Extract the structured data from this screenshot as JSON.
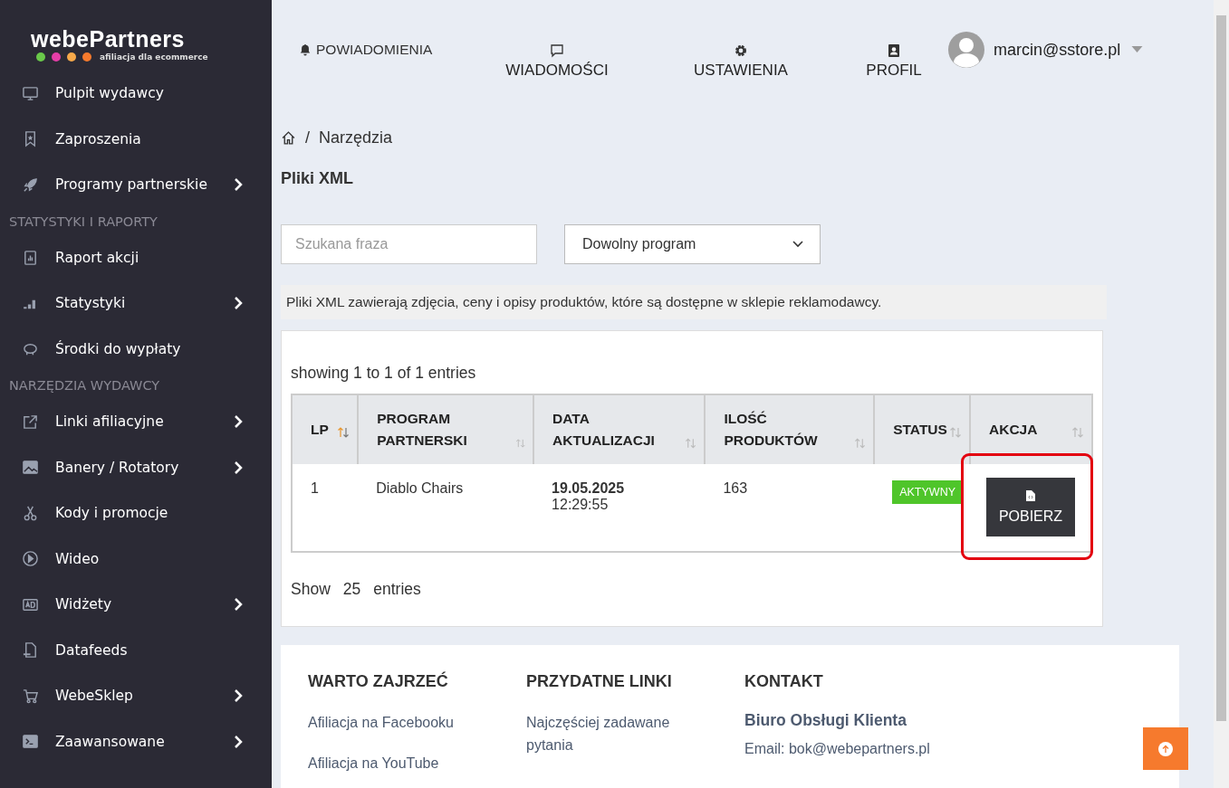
{
  "logo": {
    "name": "webePartners",
    "tagline": "afiliacja dla ecommerce",
    "dots": [
      {
        "color": "#6ac94a"
      },
      {
        "color": "#e53ea8"
      },
      {
        "color": "#f7a94a"
      },
      {
        "color": "#f67a2d"
      }
    ]
  },
  "sidebar": {
    "items": [
      {
        "kind": "link",
        "label": "Pulpit wydawcy",
        "submenu": false
      },
      {
        "kind": "link",
        "label": "Zaproszenia",
        "submenu": false
      },
      {
        "kind": "link",
        "label": "Programy partnerskie",
        "submenu": true
      },
      {
        "kind": "heading",
        "label": "STATYSTYKI I RAPORTY"
      },
      {
        "kind": "link",
        "label": "Raport akcji",
        "submenu": false
      },
      {
        "kind": "link",
        "label": "Statystyki",
        "submenu": true
      },
      {
        "kind": "link",
        "label": "Środki do wypłaty",
        "submenu": false
      },
      {
        "kind": "heading",
        "label": "NARZĘDZIA WYDAWCY"
      },
      {
        "kind": "link",
        "label": "Linki afiliacyjne",
        "submenu": true
      },
      {
        "kind": "link",
        "label": "Banery / Rotatory",
        "submenu": true
      },
      {
        "kind": "link",
        "label": "Kody i promocje",
        "submenu": false
      },
      {
        "kind": "link",
        "label": "Wideo",
        "submenu": false
      },
      {
        "kind": "link",
        "label": "Widżety",
        "submenu": true
      },
      {
        "kind": "link",
        "label": "Datafeeds",
        "submenu": false
      },
      {
        "kind": "link",
        "label": "WebeSklep",
        "submenu": true
      },
      {
        "kind": "link",
        "label": "Zaawansowane",
        "submenu": true
      }
    ]
  },
  "topbar": {
    "notifications": "POWIADOMIENIA",
    "nav": [
      "WIADOMOŚCI",
      "USTAWIENIA",
      "PROFIL"
    ],
    "user": "marcin@sstore.pl"
  },
  "breadcrumb": {
    "separator": "/",
    "items": [
      "Narzędzia"
    ]
  },
  "title": "Pliki XML",
  "filters": {
    "search_placeholder": "Szukana fraza",
    "program_select": "Dowolny program"
  },
  "info": "Pliki XML zawierają zdjęcia, ceny i opisy produktów, które są dostępne w sklepie reklamodawcy.",
  "table": {
    "summary": "showing 1 to 1 of 1 entries",
    "columns": [
      {
        "label": "LP",
        "sorted": true
      },
      {
        "label": "PROGRAM PARTNERSKI",
        "sorted": false
      },
      {
        "label": "DATA AKTUALIZACJI",
        "sorted": false
      },
      {
        "label": "ILOŚĆ PRODUKTÓW",
        "sorted": false
      },
      {
        "label": "STATUS",
        "sorted": false
      },
      {
        "label": "AKCJA",
        "sorted": false
      }
    ],
    "rows": [
      {
        "lp": "1",
        "program": "Diablo Chairs",
        "date": "19.05.2025",
        "time": "12:29:55",
        "count": "163",
        "status": "AKTYWNY",
        "active": true,
        "action": "POBIERZ",
        "highlighted": true
      }
    ],
    "show_label": "Show",
    "page_size": "25",
    "entries_label": "entries"
  },
  "footer": {
    "columns": [
      {
        "heading": "WARTO ZAJRZEĆ",
        "links": [
          "Afiliacja na Facebooku",
          "Afiliacja na YouTube"
        ]
      },
      {
        "heading": "PRZYDATNE LINKI",
        "links": [
          "Najczęściej zadawane pytania"
        ]
      },
      {
        "heading": "KONTAKT",
        "strong": "Biuro Obsługi Klienta",
        "links": [
          "Email: bok@webepartners.pl"
        ]
      }
    ]
  }
}
